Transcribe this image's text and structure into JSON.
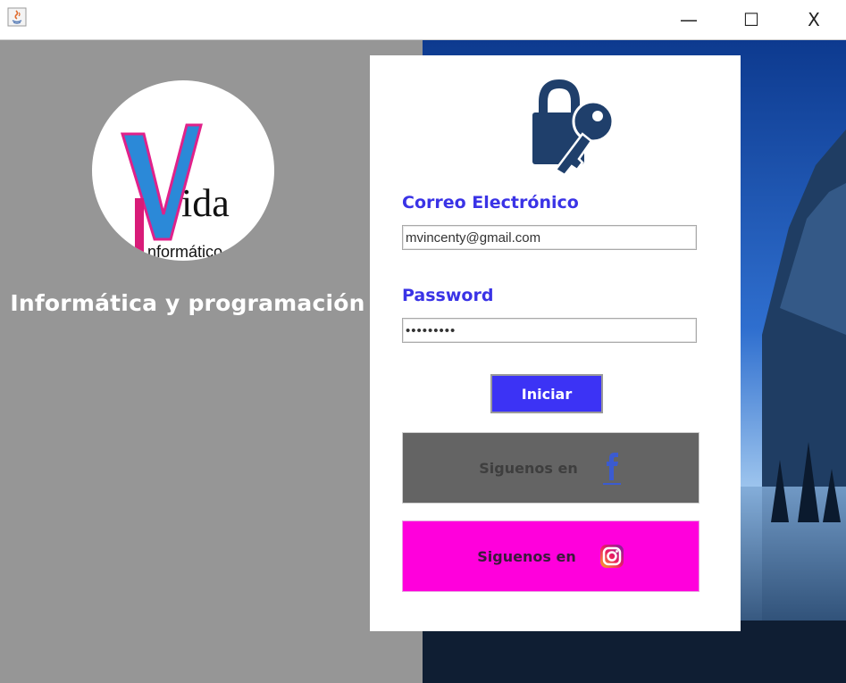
{
  "window": {
    "title": "",
    "controls": {
      "minimize": "—",
      "maximize": "☐",
      "close": "X"
    }
  },
  "left": {
    "logo": {
      "big_letter": "V",
      "word": "ida",
      "sub_letter": "I",
      "sub_word": "nformático"
    },
    "tagline": "Informática y programación"
  },
  "login": {
    "email_label": "Correo Electrónico",
    "email_value": "mvincenty@gmail.com",
    "password_label": "Password",
    "password_value": "•••••••••",
    "submit_label": "Iniciar",
    "facebook_text": "Siguenos en",
    "instagram_text": "Siguenos en"
  },
  "colors": {
    "left_panel": "#969696",
    "label_blue": "#3a33e6",
    "button_blue": "#3c33f5",
    "facebook_bg": "#646464",
    "instagram_bg": "#ff00dc",
    "lock_icon": "#1f3f6b"
  },
  "icons": [
    "java-app-icon",
    "lock-key-icon",
    "facebook-icon",
    "instagram-icon"
  ]
}
